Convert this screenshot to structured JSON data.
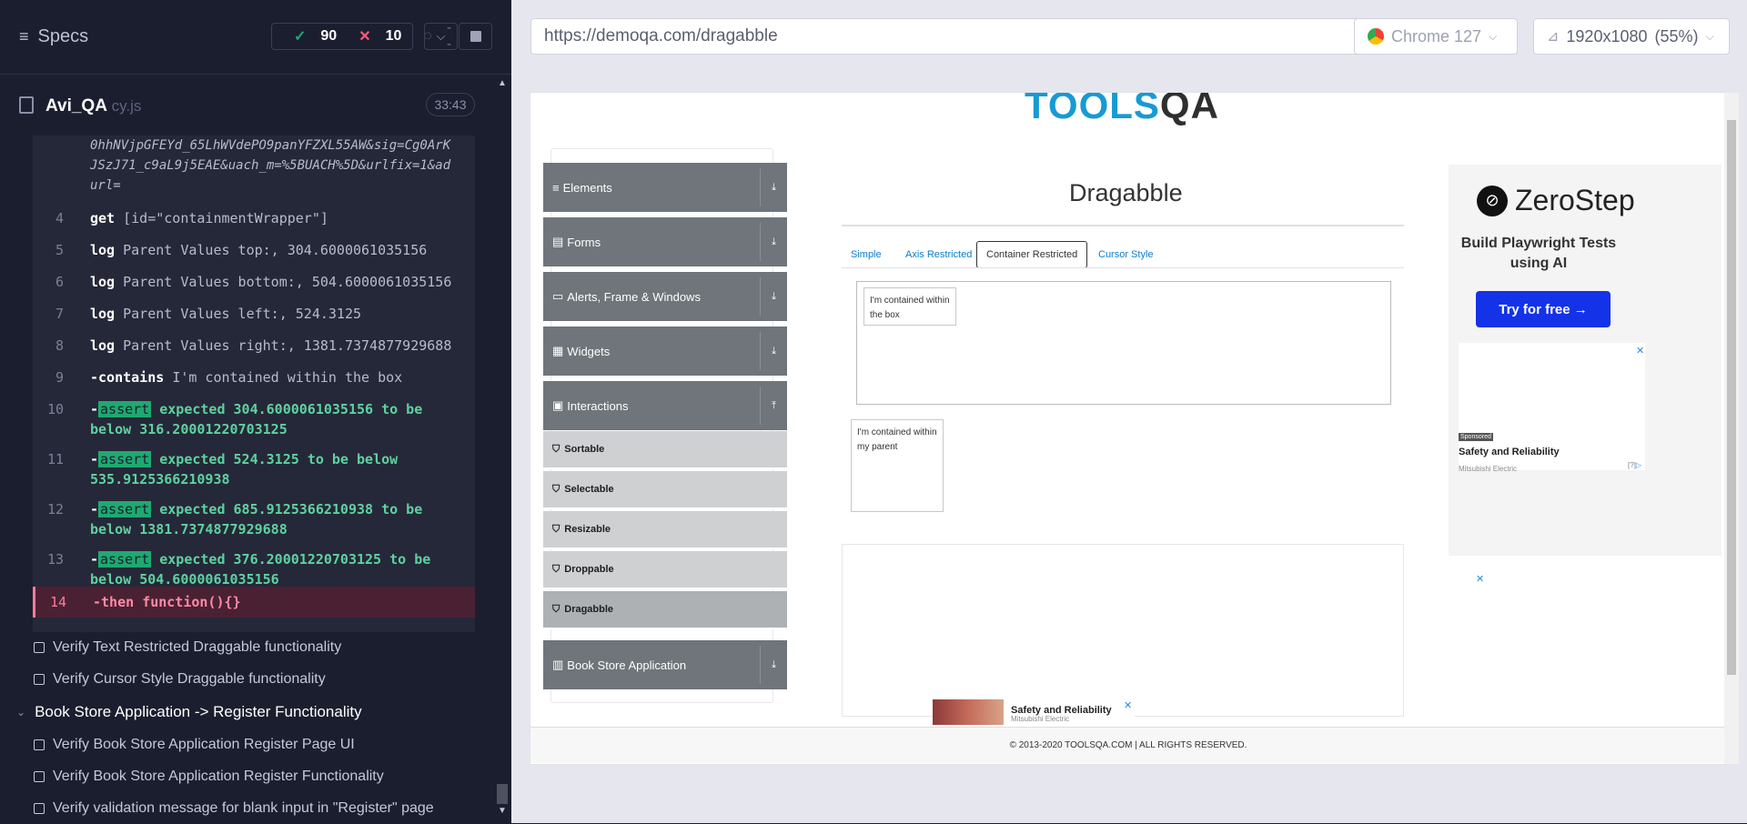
{
  "header": {
    "title": "Specs",
    "passed": "90",
    "failed": "10",
    "pending": "--"
  },
  "file": {
    "name": "Avi_QA",
    "ext": " cy.js",
    "time": "33:43"
  },
  "commands": {
    "url_tail": [
      "0hhNVjpGFEYd_65LhWVdePO9panYFZXL55AW&sig=Cg0ArK",
      "JSzJ71_c9aL9j5EAE&uach_m=%5BUACH%5D&urlfix=1&ad",
      "url="
    ],
    "items": [
      {
        "n": "4",
        "kw": "get",
        "text": "[id=\"containmentWrapper\"]"
      },
      {
        "n": "5",
        "kw": "log",
        "text": "Parent Values top:, 304.6000061035156"
      },
      {
        "n": "6",
        "kw": "log",
        "text": "Parent Values bottom:, 504.6000061035156"
      },
      {
        "n": "7",
        "kw": "log",
        "text": "Parent Values left:, 524.3125"
      },
      {
        "n": "8",
        "kw": "log",
        "text": "Parent Values right:, 1381.7374877929688"
      },
      {
        "n": "9",
        "kw": "-contains",
        "text": "I'm contained within the box"
      }
    ],
    "asserts": [
      {
        "n": "10",
        "tag": "assert",
        "l1a": "expected",
        "v1": "304.6000061035156",
        "l1b": "to be",
        "l2a": "below",
        "v2": "316.20001220703125"
      },
      {
        "n": "11",
        "tag": "assert",
        "l1a": "expected",
        "v1": "524.3125",
        "l1b": "to be below",
        "l2a": "",
        "v2": "535.9125366210938"
      },
      {
        "n": "12",
        "tag": "assert",
        "l1a": "expected",
        "v1": "685.9125366210938",
        "l1b": "to be",
        "l2a": "below",
        "v2": "1381.7374877929688"
      },
      {
        "n": "13",
        "tag": "assert",
        "l1a": "expected",
        "v1": "376.20001220703125",
        "l1b": "to be",
        "l2a": "below",
        "v2": "504.6000061035156"
      }
    ],
    "active": {
      "n": "14",
      "kw": "-then",
      "text": "function(){}"
    }
  },
  "tests": [
    {
      "label": "Verify Text Restricted Draggable functionality",
      "type": "test"
    },
    {
      "label": "Verify Cursor Style Draggable functionality",
      "type": "test"
    },
    {
      "label": "Book Store Application -> Register Functionality",
      "type": "suite"
    },
    {
      "label": "Verify Book Store Application Register Page UI",
      "type": "test"
    },
    {
      "label": "Verify Book Store Application Register Functionality",
      "type": "test"
    },
    {
      "label": "Verify validation message for blank input in \"Register\" page",
      "type": "test"
    }
  ],
  "browser": {
    "url": "https://demoqa.com/dragabble",
    "browser": "Chrome 127",
    "viewport": "1920x1080",
    "scale": "(55%)"
  },
  "page": {
    "logo_a": "TOOLS",
    "logo_b": "QA",
    "groups": [
      "Elements",
      "Forms",
      "Alerts, Frame & Windows",
      "Widgets",
      "Interactions"
    ],
    "subs": [
      "Sortable",
      "Selectable",
      "Resizable",
      "Droppable",
      "Dragabble"
    ],
    "book": "Book Store Application",
    "title": "Dragabble",
    "tabs": [
      "Simple",
      "Axis Restricted",
      "Container Restricted",
      "Cursor Style"
    ],
    "box1": "I'm contained within the box",
    "box2": "I'm contained within my parent",
    "footer": "© 2013-2020 TOOLSQA.COM | ALL RIGHTS RESERVED.",
    "ad": {
      "brand": "ZeroStep",
      "headline": "Build Playwright Tests using AI",
      "cta": "Try for free →",
      "sponsored": "Sponsored",
      "adtitle": "Safety and Reliability",
      "advertiser": "Mitsubishi Electric",
      "info": "[?]"
    }
  }
}
